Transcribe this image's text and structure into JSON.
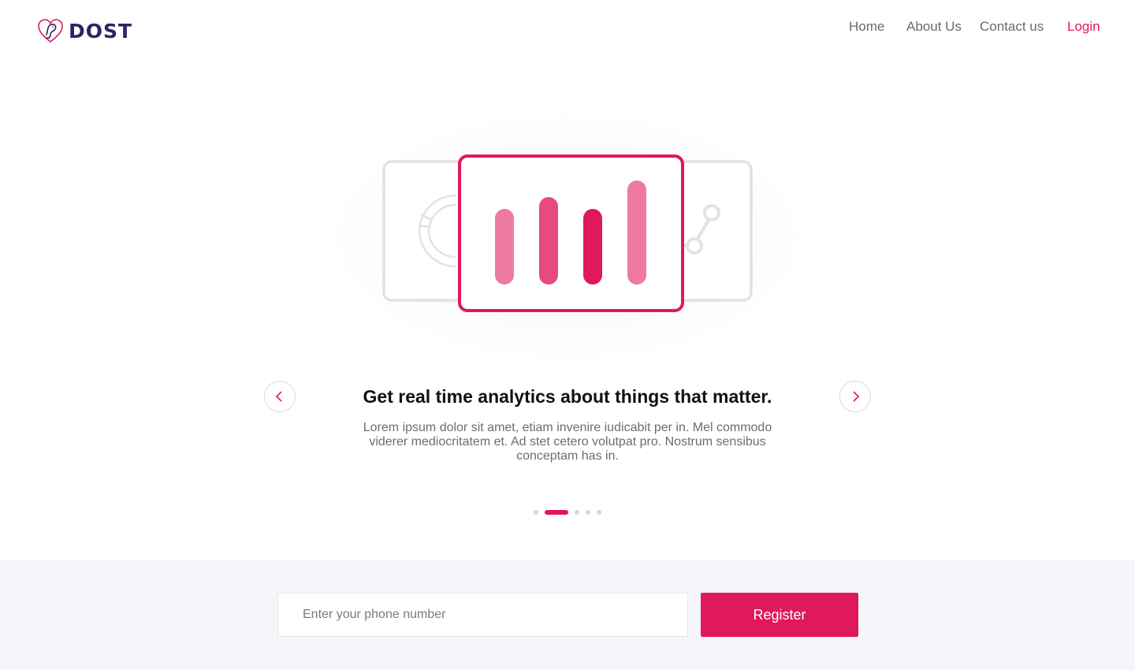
{
  "brand": {
    "name": "DOST",
    "logo_icon": "heart-bear-icon",
    "color": "#2c2462"
  },
  "accent_color": "#e0185c",
  "nav": {
    "items": [
      {
        "label": "Home"
      },
      {
        "label": "About Us"
      },
      {
        "label": "Contact us"
      }
    ],
    "login_label": "Login"
  },
  "carousel": {
    "illustration_icon": "bar-chart-card-icon",
    "title": "Get real time analytics about things that matter.",
    "body": "Lorem ipsum dolor sit amet, etiam invenire iudicabit per in. Mel commodo viderer mediocritatem et. Ad stet cetero volutpat pro. Nostrum sensibus conceptam has in.",
    "prev_icon": "chevron-left-icon",
    "next_icon": "chevron-right-icon",
    "slide_count": 5,
    "active_slide": 2
  },
  "register": {
    "phone_placeholder": "Enter your phone number",
    "phone_value": "",
    "button_label": "Register"
  }
}
